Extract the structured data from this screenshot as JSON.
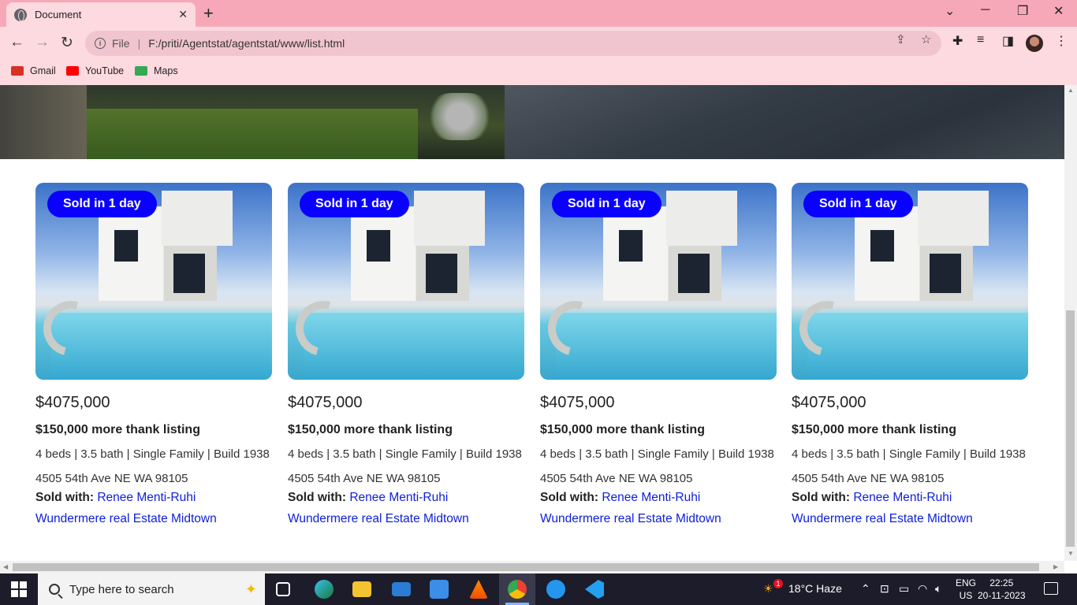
{
  "browser": {
    "tab_title": "Document",
    "tab_close": "✕",
    "new_tab": "+",
    "address_scheme": "File",
    "address_url": "F:/priti/Agentstat/agentstat/www/list.html",
    "bookmarks": [
      {
        "label": "Gmail",
        "icon": "gmail-icon",
        "color": "#d93025"
      },
      {
        "label": "YouTube",
        "icon": "youtube-icon",
        "color": "#ff0000"
      },
      {
        "label": "Maps",
        "icon": "maps-icon",
        "color": "#34a853"
      }
    ]
  },
  "listings": [
    {
      "badge": "Sold in 1 day",
      "price": "$4075,000",
      "more": "$150,000 more thank listing",
      "specs": "4 beds | 3.5 bath | Single Family | Build 1938",
      "address": "4505 54th Ave NE WA 98105",
      "sold_with_label": "Sold with:",
      "agent": "Renee Menti-Ruhi",
      "office": "Wundermere real Estate Midtown"
    },
    {
      "badge": "Sold in 1 day",
      "price": "$4075,000",
      "more": "$150,000 more thank listing",
      "specs": "4 beds | 3.5 bath | Single Family | Build 1938",
      "address": "4505 54th Ave NE WA 98105",
      "sold_with_label": "Sold with:",
      "agent": "Renee Menti-Ruhi",
      "office": "Wundermere real Estate Midtown"
    },
    {
      "badge": "Sold in 1 day",
      "price": "$4075,000",
      "more": "$150,000 more thank listing",
      "specs": "4 beds | 3.5 bath | Single Family | Build 1938",
      "address": "4505 54th Ave NE WA 98105",
      "sold_with_label": "Sold with:",
      "agent": "Renee Menti-Ruhi",
      "office": "Wundermere real Estate Midtown"
    },
    {
      "badge": "Sold in 1 day",
      "price": "$4075,000",
      "more": "$150,000 more thank listing",
      "specs": "4 beds | 3.5 bath | Single Family | Build 1938",
      "address": "4505 54th Ave NE WA 98105",
      "sold_with_label": "Sold with:",
      "agent": "Renee Menti-Ruhi",
      "office": "Wundermere real Estate Midtown"
    }
  ],
  "colors": {
    "badge_bg": "#0a00ff",
    "link": "#1020d8",
    "tabbar": "#f7a8b8",
    "toolbar": "#fdd9e0"
  },
  "taskbar": {
    "search_placeholder": "Type here to search",
    "weather": "18°C  Haze",
    "weather_badge": "1",
    "lang_top": "ENG",
    "lang_bottom": "US",
    "time": "22:25",
    "date": "20-11-2023"
  }
}
